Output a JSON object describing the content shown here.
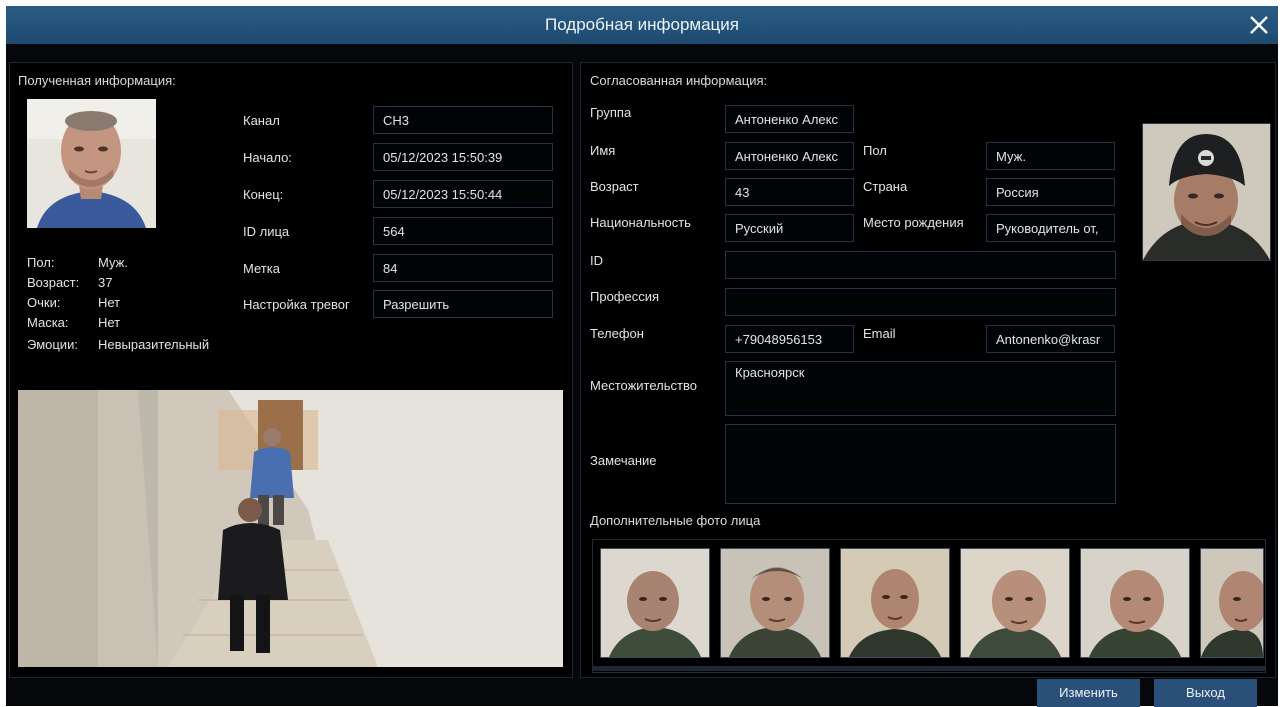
{
  "dialog": {
    "title": "Подробная информация"
  },
  "received": {
    "section_title": "Полученная информация:",
    "fields": [
      {
        "label": "Канал",
        "value": "CH3"
      },
      {
        "label": "Начало:",
        "value": "05/12/2023 15:50:39"
      },
      {
        "label": "Конец:",
        "value": "05/12/2023 15:50:44"
      },
      {
        "label": "ID лица",
        "value": "564"
      },
      {
        "label": "Метка",
        "value": "84"
      },
      {
        "label": "Настройка тревог",
        "value": "Разрешить"
      }
    ],
    "attributes": [
      {
        "label": "Пол:",
        "value": "Муж."
      },
      {
        "label": "Возраст:",
        "value": "37"
      },
      {
        "label": "Очки:",
        "value": "Нет"
      },
      {
        "label": "Маска:",
        "value": "Нет"
      },
      {
        "label": "Эмоции:",
        "value": "Невыразительный"
      }
    ]
  },
  "matched": {
    "section_title": "Согласованная информация:",
    "group": {
      "label": "Группа",
      "value": "Антоненко Алекс"
    },
    "name": {
      "label": "Имя",
      "value": "Антоненко Алекс"
    },
    "gender": {
      "label": "Пол",
      "value": "Муж."
    },
    "age": {
      "label": "Возраст",
      "value": "43"
    },
    "country": {
      "label": "Страна",
      "value": "Россия"
    },
    "nationality": {
      "label": "Национальность",
      "value": "Русский"
    },
    "birthplace": {
      "label": "Место рождения",
      "value": "Руководитель от,"
    },
    "id": {
      "label": "ID",
      "value": ""
    },
    "profession": {
      "label": "Профессия",
      "value": ""
    },
    "phone": {
      "label": "Телефон",
      "value": "+79048956153"
    },
    "email": {
      "label": "Email",
      "value": "Antonenko@krasr"
    },
    "residence": {
      "label": "Местожительство",
      "value": "Красноярск"
    },
    "remark": {
      "label": "Замечание",
      "value": ""
    },
    "extra_photos_title": "Дополнительные фото лица"
  },
  "buttons": {
    "edit": "Изменить",
    "exit": "Выход"
  },
  "colors": {
    "titlebar": "#1e4a6f",
    "button": "#2a4f78",
    "field_border": "#243347"
  },
  "icons": {
    "close": "close-icon"
  }
}
